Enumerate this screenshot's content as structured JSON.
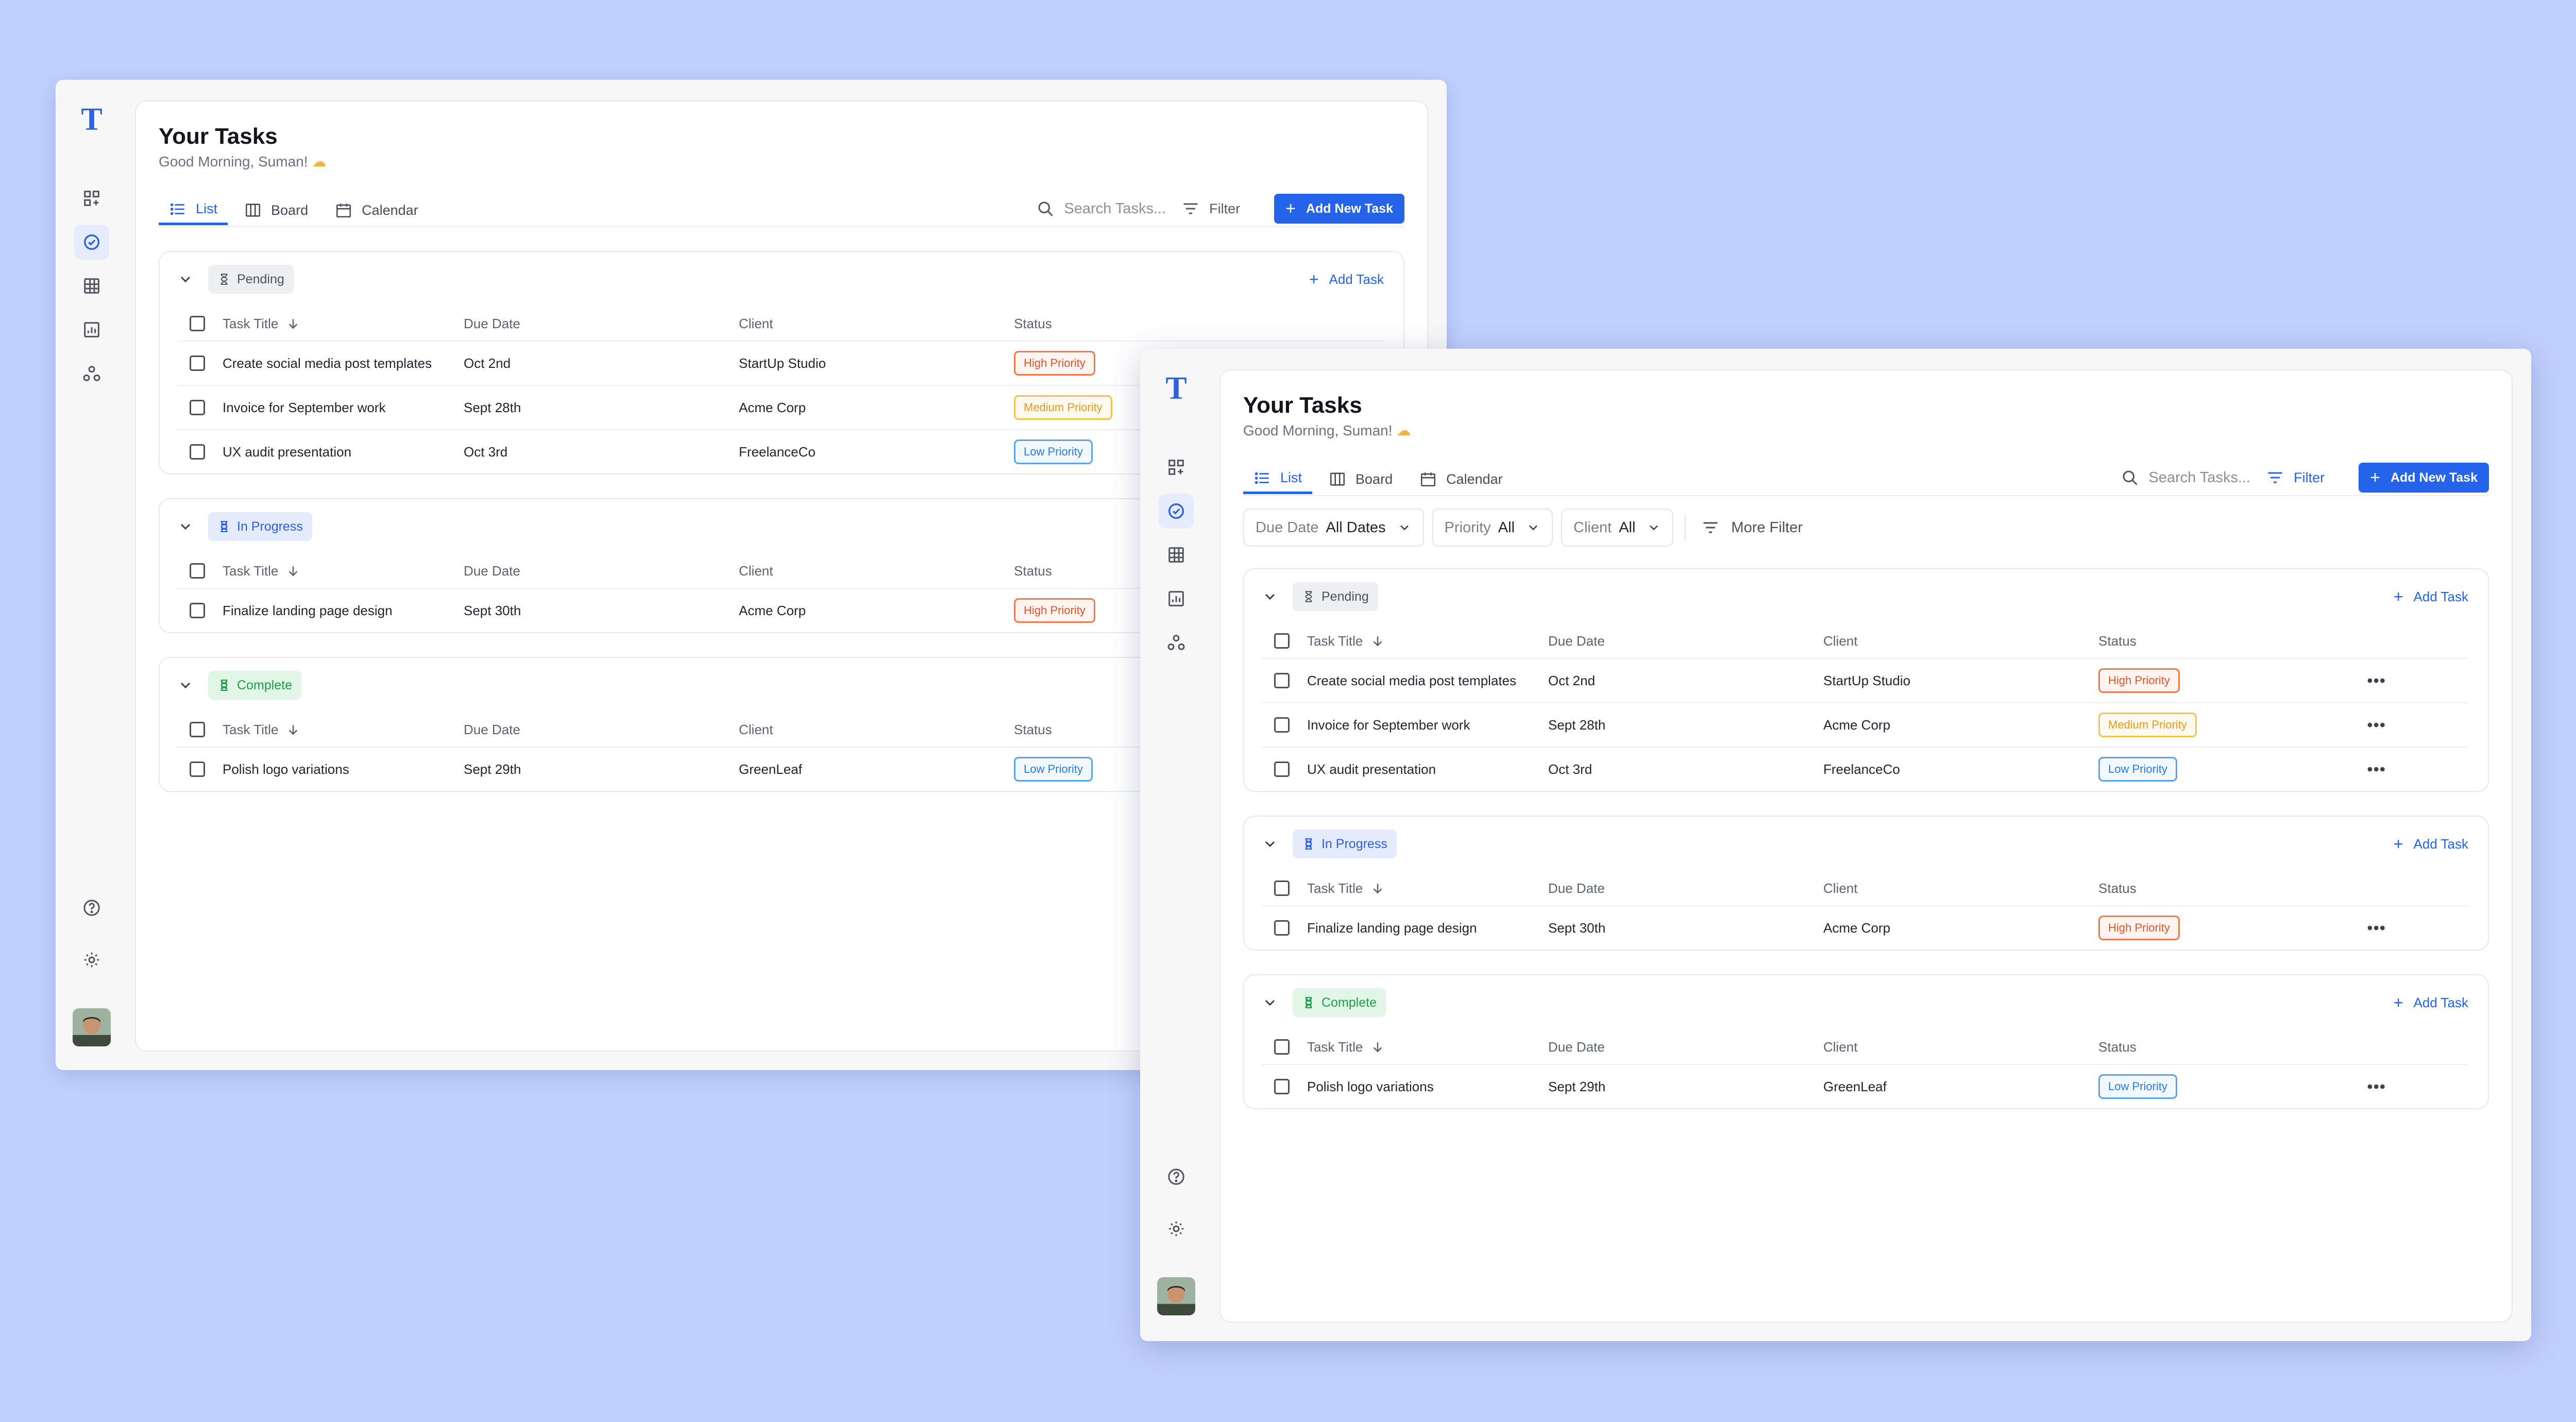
{
  "app": {
    "logo": "T",
    "title": "Your Tasks",
    "greeting": "Good Morning, Suman!",
    "greeting_icon": "☁",
    "tabs": [
      {
        "label": "List",
        "icon": "list-icon",
        "active": true
      },
      {
        "label": "Board",
        "icon": "board-icon",
        "active": false
      },
      {
        "label": "Calendar",
        "icon": "calendar-icon",
        "active": false
      }
    ],
    "search_placeholder": "Search Tasks...",
    "filter_label": "Filter",
    "add_new_task": "Add New Task",
    "add_task": "Add Task",
    "filters": [
      {
        "key": "Due Date",
        "value": "All Dates"
      },
      {
        "key": "Priority",
        "value": "All"
      },
      {
        "key": "Client",
        "value": "All"
      }
    ],
    "more_filter": "More Filter",
    "columns": {
      "title": "Task Title",
      "due": "Due Date",
      "client": "Client",
      "status": "Status"
    },
    "colors": {
      "accent": "#2563eb",
      "background": "#c0d0fe",
      "high": "#e1522a",
      "medium": "#e79a1a",
      "low": "#2a7ad8",
      "complete": "#1e9e4a"
    },
    "groups": [
      {
        "status": "Pending",
        "icon": "hourglass-icon",
        "tasks": [
          {
            "title": "Create social media post templates",
            "due": "Oct 2nd",
            "client": "StartUp Studio",
            "priority": "High Priority"
          },
          {
            "title": "Invoice for September work",
            "due": "Sept 28th",
            "client": "Acme Corp",
            "priority": "Medium Priority"
          },
          {
            "title": "UX audit presentation",
            "due": "Oct 3rd",
            "client": "FreelanceCo",
            "priority": "Low Priority"
          }
        ]
      },
      {
        "status": "In Progress",
        "icon": "hourglass-icon",
        "tasks": [
          {
            "title": "Finalize landing page design",
            "due": "Sept 30th",
            "client": "Acme Corp",
            "priority": "High Priority"
          }
        ]
      },
      {
        "status": "Complete",
        "icon": "hourglass-icon",
        "tasks": [
          {
            "title": "Polish logo variations",
            "due": "Sept 29th",
            "client": "GreenLeaf",
            "priority": "Low Priority"
          }
        ]
      }
    ],
    "row_menu": "•••"
  }
}
